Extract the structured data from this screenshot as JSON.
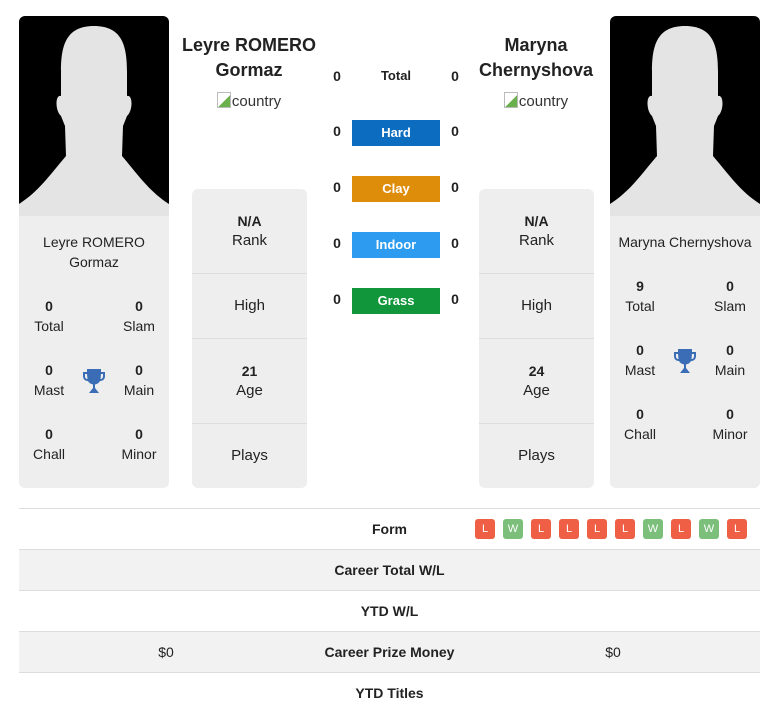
{
  "player1": {
    "name_line1": "Leyre ROMERO",
    "name_line2": "Gormaz",
    "card_name_line1": "Leyre ROMERO",
    "card_name_line2": "Gormaz",
    "flag_alt": "country",
    "rank": "N/A",
    "rank_label": "Rank",
    "high_label": "High",
    "age": "21",
    "age_label": "Age",
    "plays_label": "Plays",
    "titles": {
      "total": "0",
      "total_label": "Total",
      "slam": "0",
      "slam_label": "Slam",
      "mast": "0",
      "mast_label": "Mast",
      "main": "0",
      "main_label": "Main",
      "chall": "0",
      "chall_label": "Chall",
      "minor": "0",
      "minor_label": "Minor"
    },
    "prize_money": "$0"
  },
  "player2": {
    "name_line1": "Maryna",
    "name_line2": "Chernyshova",
    "card_name": "Maryna Chernyshova",
    "flag_alt": "country",
    "rank": "N/A",
    "rank_label": "Rank",
    "high_label": "High",
    "age": "24",
    "age_label": "Age",
    "plays_label": "Plays",
    "titles": {
      "total": "9",
      "total_label": "Total",
      "slam": "0",
      "slam_label": "Slam",
      "mast": "0",
      "mast_label": "Mast",
      "main": "0",
      "main_label": "Main",
      "chall": "0",
      "chall_label": "Chall",
      "minor": "0",
      "minor_label": "Minor"
    },
    "prize_money": "$0"
  },
  "surfaces": [
    {
      "label": "Total",
      "p1": "0",
      "p2": "0",
      "color": null
    },
    {
      "label": "Hard",
      "p1": "0",
      "p2": "0",
      "color": "#0c6cc0"
    },
    {
      "label": "Clay",
      "p1": "0",
      "p2": "0",
      "color": "#de8d0a"
    },
    {
      "label": "Indoor",
      "p1": "0",
      "p2": "0",
      "color": "#2d9cf0"
    },
    {
      "label": "Grass",
      "p1": "0",
      "p2": "0",
      "color": "#11963c"
    }
  ],
  "comparison": {
    "form_label": "Form",
    "form": [
      "L",
      "W",
      "L",
      "L",
      "L",
      "L",
      "W",
      "L",
      "W",
      "L"
    ],
    "form_colors": {
      "W": "#7bbf7b",
      "L": "#ee5f45"
    },
    "career_wl_label": "Career Total W/L",
    "ytd_wl_label": "YTD W/L",
    "prize_label": "Career Prize Money",
    "ytd_titles_label": "YTD Titles"
  },
  "colors": {
    "trophy": "#3a6db5"
  }
}
